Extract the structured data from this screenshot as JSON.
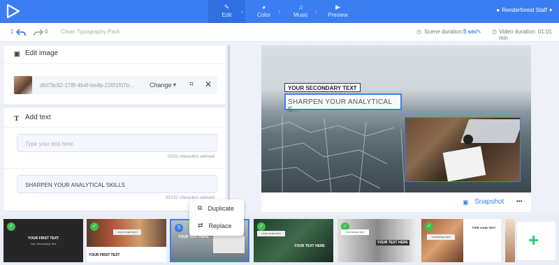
{
  "header": {
    "steps": [
      {
        "label": "Edit",
        "icon": "pencil-icon"
      },
      {
        "label": "Color",
        "icon": "palette-icon"
      },
      {
        "label": "Music",
        "icon": "music-icon"
      },
      {
        "label": "Preview",
        "icon": "play-icon"
      }
    ],
    "user": "Renderforest Staff"
  },
  "subbar": {
    "undo_count": "1",
    "redo_count": "0",
    "project_name": "Clean Typography Pack",
    "scene_duration_label": "Scene duration:",
    "scene_duration_value": "5 sec",
    "video_duration": "Video duration: 01:01 min"
  },
  "edit_image": {
    "title": "Edit image",
    "file_name": "dfd79c92-278f-4b4f-be4b-226f1f07b...",
    "change_label": "Change"
  },
  "add_text": {
    "title": "Add text",
    "field1": {
      "placeholder": "Type your text here",
      "counter": "0/231 characters advised"
    },
    "field2": {
      "value": "SHARPEN YOUR ANALYTICAL SKILLS",
      "counter": "30/132 characters advised"
    }
  },
  "preview": {
    "secondary_text": "YOUR SECONDARY TEXT",
    "main_text": "SHARPEN YOUR ANALYTICAL S...",
    "snapshot_label": "Snapshot",
    "more_label": "•••"
  },
  "context_menu": {
    "duplicate": "Duplicate",
    "replace": "Replace"
  },
  "filmstrip": [
    {
      "title": "YOUR FIRST TEXT",
      "subtitle": "Your Secondary Text",
      "checked": true
    },
    {
      "title": "YOUR FIRST TEXT",
      "subtitle": "YOUR OTHER TEXT",
      "checked": true
    },
    {
      "title": "YOUR TEXT HERE",
      "badge": "3",
      "selected": true
    },
    {
      "title": "YOUR TEXT HERE",
      "subtitle": "YOUR OTHER TEXT",
      "checked": true
    },
    {
      "title": "YOUR TEXT HERE",
      "subtitle": "YOUR IMAGE TEXT",
      "checked": true
    },
    {
      "title": "TYPE YOUR TEXT",
      "subtitle": "YOUR IMAGE TEXT",
      "checked": true
    }
  ],
  "colors": {
    "accent": "#3b7ef1",
    "add_plus": "#2ecc71",
    "check": "#3fbf4f"
  }
}
